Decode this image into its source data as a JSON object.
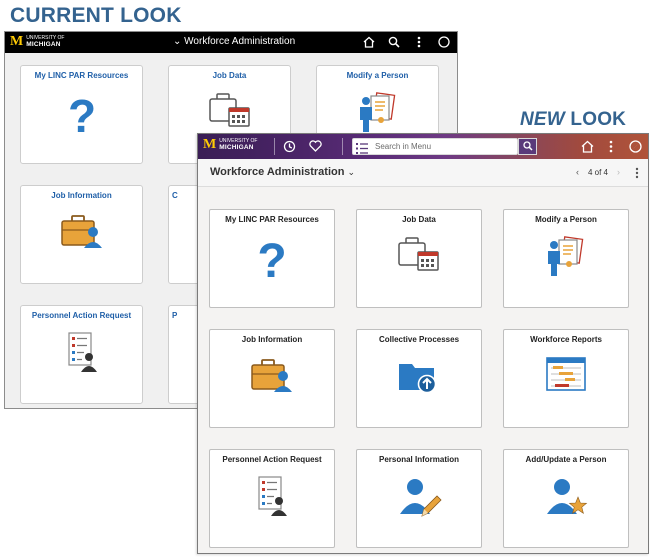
{
  "captions": {
    "current": "CURRENT LOOK",
    "new_emph": "NEW",
    "new_rest": " LOOK"
  },
  "brand": {
    "university": "UNIVERSITY OF",
    "name": "MICHIGAN",
    "mark": "M",
    "maize": "#ffcb05"
  },
  "old": {
    "title": "Workforce Administration",
    "tiles": [
      {
        "label": "My LINC PAR Resources",
        "icon": "question-icon"
      },
      {
        "label": "Job Data",
        "icon": "briefcase-calendar-icon"
      },
      {
        "label": "Modify a Person",
        "icon": "person-document-icon"
      },
      {
        "label": "Job Information",
        "icon": "briefcase-person-icon"
      },
      {
        "label": "C",
        "icon": "folder-icon"
      },
      {
        "label": "",
        "icon": ""
      },
      {
        "label": "Personnel Action Request",
        "icon": "form-person-icon"
      },
      {
        "label": "P",
        "icon": ""
      }
    ]
  },
  "new": {
    "search_placeholder": "Search in Menu",
    "page_title": "Workforce Administration",
    "pager": "4 of 4",
    "tiles": [
      {
        "label": "My LINC PAR Resources",
        "icon": "question-icon"
      },
      {
        "label": "Job Data",
        "icon": "briefcase-calendar-icon"
      },
      {
        "label": "Modify a Person",
        "icon": "person-document-icon"
      },
      {
        "label": "Job Information",
        "icon": "briefcase-person-icon"
      },
      {
        "label": "Collective Processes",
        "icon": "folder-upload-icon"
      },
      {
        "label": "Workforce Reports",
        "icon": "report-chart-icon"
      },
      {
        "label": "Personnel Action Request",
        "icon": "form-person-icon"
      },
      {
        "label": "Personal Information",
        "icon": "person-pencil-icon"
      },
      {
        "label": "Add/Update a Person",
        "icon": "person-star-icon"
      }
    ]
  },
  "colors": {
    "caption": "#34638f",
    "tile_link": "#1f5fa8",
    "icon_blue": "#2b7ac3",
    "icon_orange": "#e8a33a"
  }
}
